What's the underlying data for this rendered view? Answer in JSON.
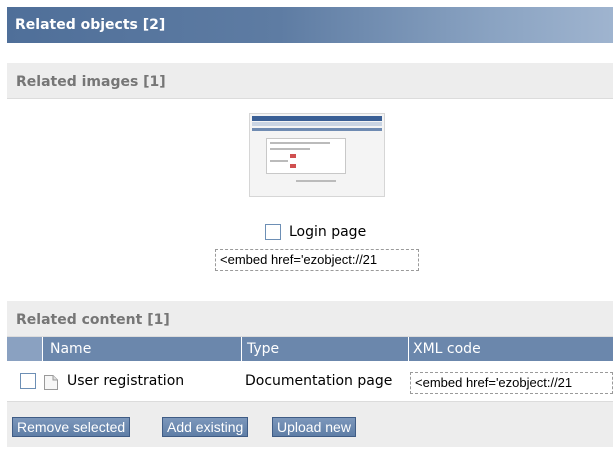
{
  "panel": {
    "title": "Related objects [2]"
  },
  "related_images": {
    "heading": "Related images [1]",
    "items": [
      {
        "label": "Login page",
        "checked": false,
        "embed_code": "<embed href='ezobject://21"
      }
    ]
  },
  "related_content": {
    "heading": "Related content [1]",
    "columns": [
      "Name",
      "Type",
      "XML code"
    ],
    "rows": [
      {
        "checked": false,
        "icon": "document-icon",
        "name": "User registration",
        "type": "Documentation page",
        "xml_code": "<embed href='ezobject://21"
      }
    ]
  },
  "buttons": {
    "remove_selected": "Remove selected",
    "add_existing": "Add existing",
    "upload_new": "Upload new"
  },
  "colors": {
    "header_start": "#4f6f99",
    "header_end": "#9fb4cf",
    "section_bg": "#ededed",
    "table_header": "#6b87ac",
    "button": "#6b87ac"
  }
}
